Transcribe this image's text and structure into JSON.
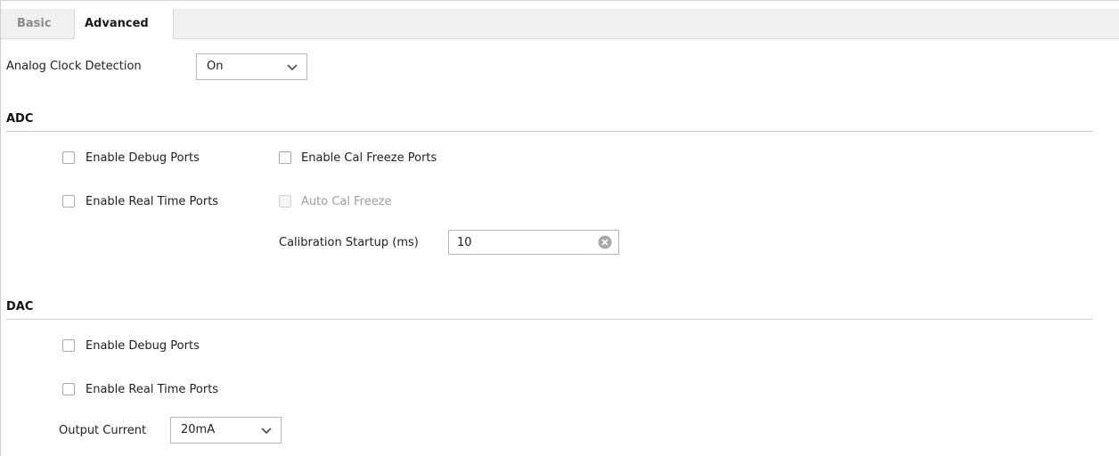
{
  "tabs": {
    "basic": "Basic",
    "advanced": "Advanced"
  },
  "analog_clock": {
    "label": "Analog Clock Detection",
    "value": "On"
  },
  "adc": {
    "title": "ADC",
    "enable_debug_ports": "Enable Debug Ports",
    "enable_cal_freeze_ports": "Enable Cal Freeze Ports",
    "enable_real_time_ports": "Enable Real Time Ports",
    "auto_cal_freeze": "Auto Cal Freeze",
    "calibration_startup_label": "Calibration Startup (ms)",
    "calibration_startup_value": "10"
  },
  "dac": {
    "title": "DAC",
    "enable_debug_ports": "Enable Debug Ports",
    "enable_real_time_ports": "Enable Real Time Ports",
    "output_current_label": "Output Current",
    "output_current_value": "20mA"
  },
  "colors": {
    "tabbar_bg": "#f0f0f0",
    "border": "#b9b9b9",
    "disabled_text": "#9e9e9e"
  }
}
